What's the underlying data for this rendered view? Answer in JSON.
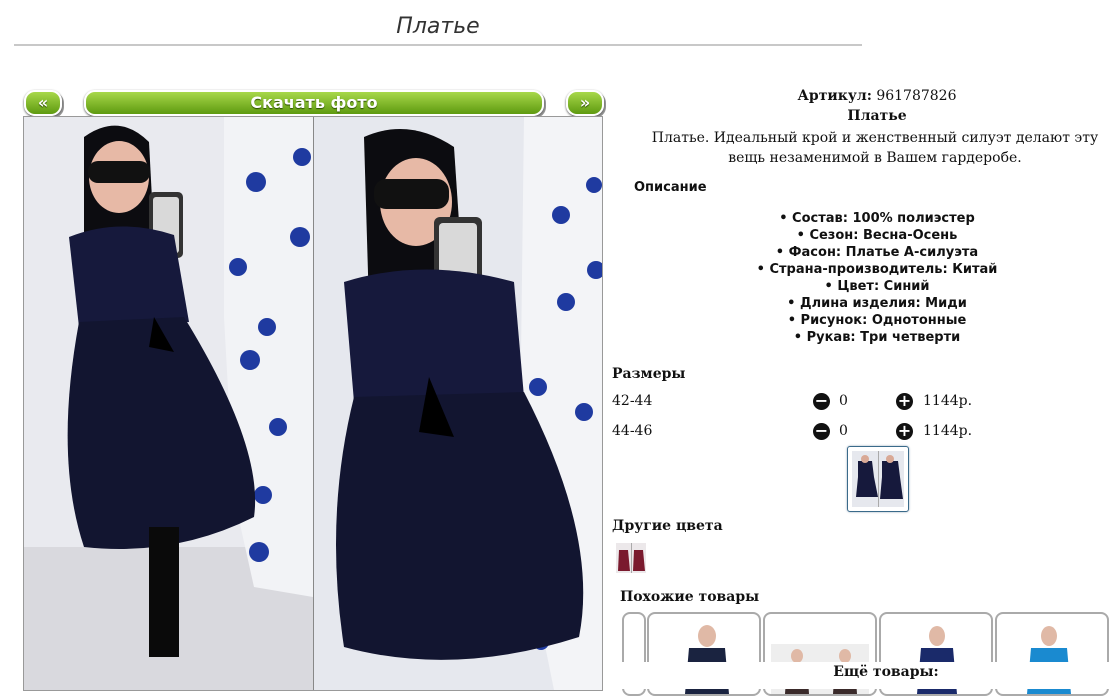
{
  "page": {
    "title": "Платье"
  },
  "gallery": {
    "prev_label": "«",
    "download_label": "Скачать фото",
    "next_label": "»"
  },
  "product": {
    "sku_label": "Артикул:",
    "sku_value": "961787826",
    "name": "Платье",
    "description": "Платье. Идеальный крой и женственный силуэт делают эту вещь незаменимой в Вашем гардеробе."
  },
  "specs": {
    "heading": "Описание",
    "items": [
      "Состав: 100% полиэстер",
      "Сезон: Весна-Осень",
      "Фасон: Платье А-силуэта",
      "Страна-производитель: Китай",
      "Цвет: Синий",
      "Длина изделия: Миди",
      "Рисунок: Однотонные",
      "Рукав: Три четверти"
    ]
  },
  "sizes": {
    "heading": "Размеры",
    "rows": [
      {
        "size": "42-44",
        "qty": "0",
        "price": "1144р."
      },
      {
        "size": "44-46",
        "qty": "0",
        "price": "1144р."
      }
    ]
  },
  "other_colors": {
    "heading": "Другие цвета"
  },
  "similar": {
    "heading": "Похожие товары"
  },
  "more": {
    "heading": "Ещё товары:"
  },
  "colors": {
    "accent_green": "#6aa51a",
    "dress_navy": "#15183a",
    "link_green": "#1a7a1a"
  },
  "icons": {
    "minus": "minus-circle-icon",
    "plus": "plus-circle-icon"
  }
}
